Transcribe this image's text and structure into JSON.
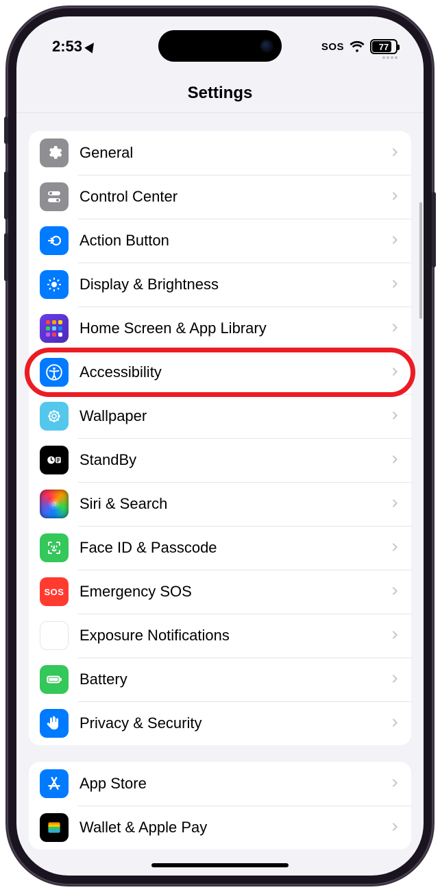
{
  "status": {
    "time": "2:53",
    "sos": "SOS",
    "battery": "77"
  },
  "header": {
    "title": "Settings"
  },
  "group1": [
    {
      "name": "general",
      "label": "General",
      "icon": "gear-icon",
      "bg": "bg-gray"
    },
    {
      "name": "control-center",
      "label": "Control Center",
      "icon": "toggles-icon",
      "bg": "bg-gray"
    },
    {
      "name": "action-button",
      "label": "Action Button",
      "icon": "action-icon",
      "bg": "bg-blue"
    },
    {
      "name": "display-brightness",
      "label": "Display & Brightness",
      "icon": "brightness-icon",
      "bg": "bg-blue"
    },
    {
      "name": "home-screen",
      "label": "Home Screen & App Library",
      "icon": "home-grid-icon",
      "bg": "bg-grid"
    },
    {
      "name": "accessibility",
      "label": "Accessibility",
      "icon": "accessibility-icon",
      "bg": "bg-blue",
      "highlight": true
    },
    {
      "name": "wallpaper",
      "label": "Wallpaper",
      "icon": "wallpaper-icon",
      "bg": "bg-cyan"
    },
    {
      "name": "standby",
      "label": "StandBy",
      "icon": "standby-icon",
      "bg": "bg-black"
    },
    {
      "name": "siri-search",
      "label": "Siri & Search",
      "icon": "siri-icon",
      "bg": "bg-gradient-siri"
    },
    {
      "name": "face-id",
      "label": "Face ID & Passcode",
      "icon": "faceid-icon",
      "bg": "bg-green"
    },
    {
      "name": "emergency-sos",
      "label": "Emergency SOS",
      "icon": "sos-icon",
      "bg": "bg-red"
    },
    {
      "name": "exposure",
      "label": "Exposure Notifications",
      "icon": "exposure-icon",
      "bg": "bg-white"
    },
    {
      "name": "battery",
      "label": "Battery",
      "icon": "battery-icon",
      "bg": "bg-green"
    },
    {
      "name": "privacy",
      "label": "Privacy & Security",
      "icon": "hand-icon",
      "bg": "bg-blue"
    }
  ],
  "group2": [
    {
      "name": "app-store",
      "label": "App Store",
      "icon": "appstore-icon",
      "bg": "bg-blue"
    },
    {
      "name": "wallet",
      "label": "Wallet & Apple Pay",
      "icon": "wallet-icon",
      "bg": "bg-black"
    }
  ]
}
